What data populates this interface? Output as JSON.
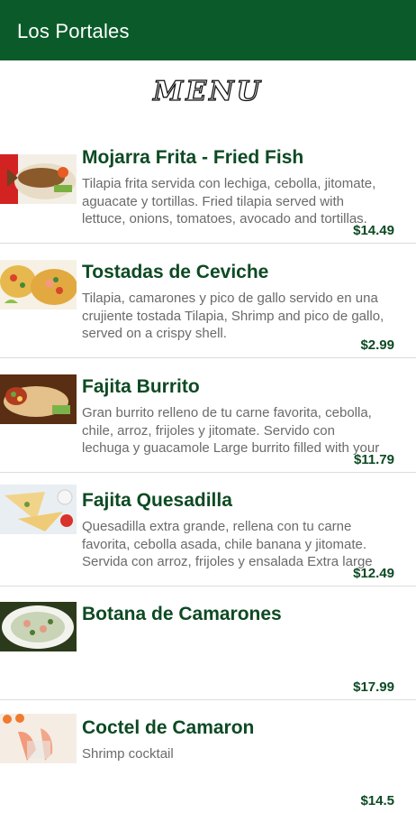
{
  "app_bar": {
    "title": "Los Portales"
  },
  "menu_heading": "MENU",
  "items": [
    {
      "name": "Mojarra Frita - Fried Fish",
      "description": "Tilapia frita servida con lechiga, cebolla, jitomate,\naguacate y tortillas. Fried tilapia served with\nlettuce, onions, tomatoes, avocado and tortillas.",
      "price": "$14.49",
      "image": "fried-fish-image"
    },
    {
      "name": "Tostadas de Ceviche",
      "description": "Tilapia, camarones y pico de gallo servido en una\ncrujiente tostada Tilapia, Shrimp and pico de gallo,\nserved on a crispy shell.",
      "price": "$2.99",
      "image": "ceviche-tostadas-image"
    },
    {
      "name": "Fajita Burrito",
      "description": "Gran burrito relleno de tu carne favorita, cebolla,\nchile, arroz, frijoles y jitomate. Servido con\nlechuga y guacamole Large burrito filled with your",
      "price": "$11.79",
      "image": "burrito-image"
    },
    {
      "name": "Fajita Quesadilla",
      "description": "Quesadilla extra grande, rellena con tu carne\nfavorita, cebolla asada, chile banana y jitomate.\nServida con arroz, frijoles y ensalada Extra large",
      "price": "$12.49",
      "image": "quesadilla-image"
    },
    {
      "name": "Botana de Camarones",
      "description": "",
      "price": "$17.99",
      "image": "shrimp-platter-image"
    },
    {
      "name": "Coctel de Camaron",
      "description": "Shrimp cocktail",
      "price": "$14.5",
      "image": "shrimp-cocktail-image"
    }
  ],
  "colors": {
    "app_bar": "#0b5b2a",
    "item_name": "#0d4a23",
    "price": "#0d4a23",
    "description": "#6a6a6a"
  }
}
